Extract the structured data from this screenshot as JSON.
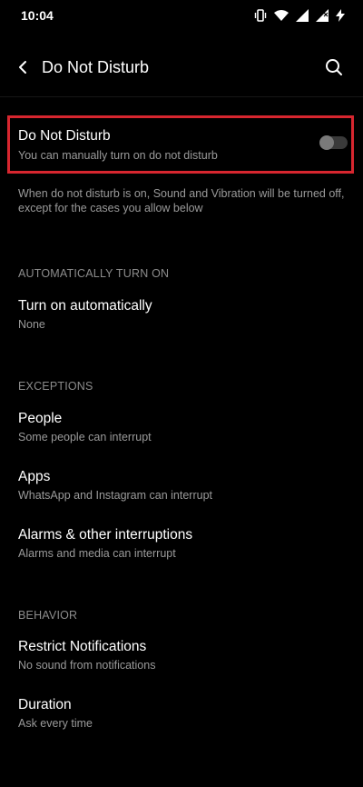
{
  "status_bar": {
    "time": "10:04"
  },
  "header": {
    "title": "Do Not Disturb"
  },
  "dnd_toggle": {
    "title": "Do Not Disturb",
    "subtitle": "You can manually turn on do not disturb",
    "enabled": false
  },
  "info_text": "When do not disturb is on, Sound and Vibration will be turned off, except for the cases you allow below",
  "sections": {
    "auto": {
      "header": "AUTOMATICALLY TURN ON",
      "turn_on_auto": {
        "title": "Turn on automatically",
        "subtitle": "None"
      }
    },
    "exceptions": {
      "header": "EXCEPTIONS",
      "people": {
        "title": "People",
        "subtitle": "Some people can interrupt"
      },
      "apps": {
        "title": "Apps",
        "subtitle": "WhatsApp and Instagram can interrupt"
      },
      "alarms": {
        "title": "Alarms & other interruptions",
        "subtitle": "Alarms and media can interrupt"
      }
    },
    "behavior": {
      "header": "BEHAVIOR",
      "restrict": {
        "title": "Restrict Notifications",
        "subtitle": "No sound from notifications"
      },
      "duration": {
        "title": "Duration",
        "subtitle": "Ask every time"
      }
    }
  },
  "colors": {
    "background": "#000000",
    "highlight_border": "#d7262f",
    "secondary_text": "#9a9a9a"
  },
  "icons": {
    "back": "chevron-left-icon",
    "search": "search-icon",
    "vibrate": "vibrate-icon",
    "wifi": "wifi-icon",
    "signal": "signal-icon",
    "battery": "battery-charging-icon"
  }
}
